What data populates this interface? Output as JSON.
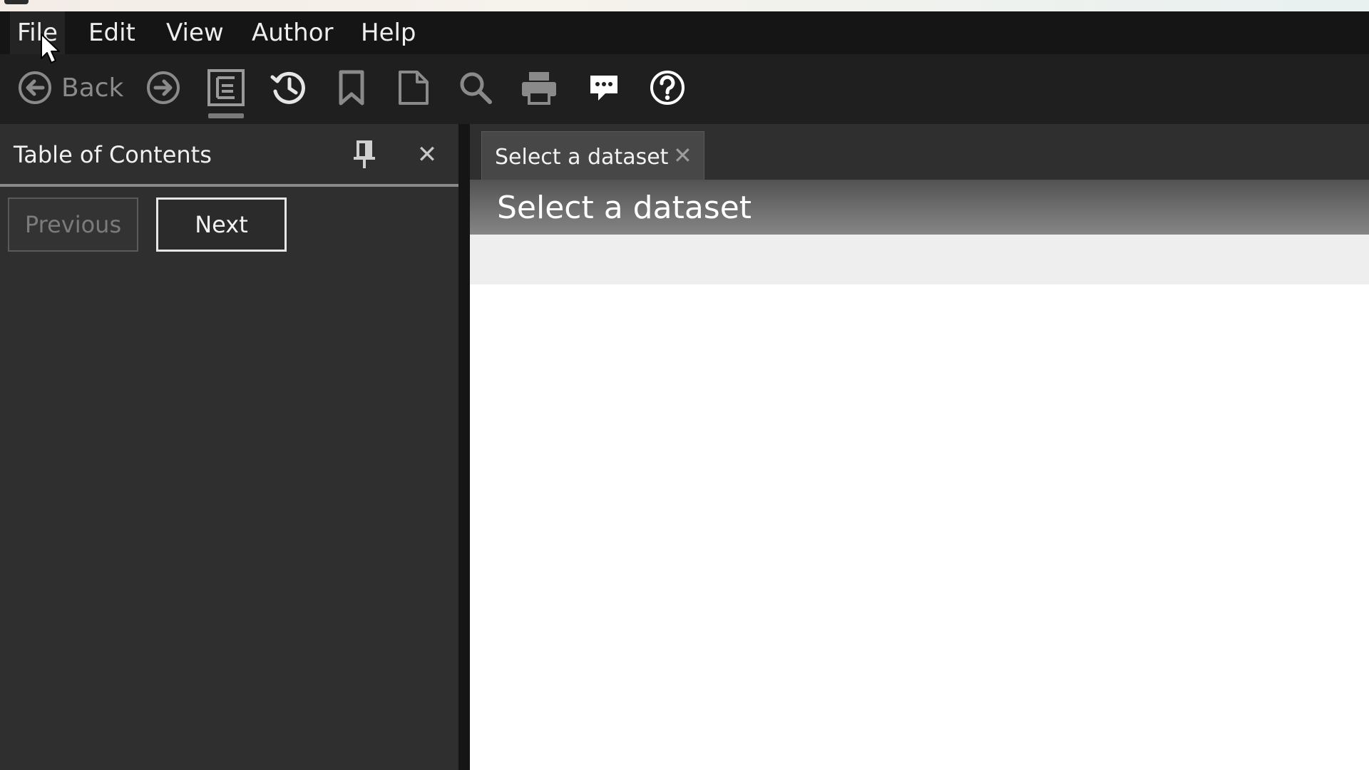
{
  "menu": {
    "items": [
      {
        "label": "File"
      },
      {
        "label": "Edit"
      },
      {
        "label": "View"
      },
      {
        "label": "Author"
      },
      {
        "label": "Help"
      }
    ]
  },
  "toolbar": {
    "back_label": "Back",
    "icons": [
      "back-icon",
      "forward-icon",
      "contents-icon",
      "history-icon",
      "bookmark-icon",
      "page-icon",
      "search-icon",
      "print-icon",
      "feedback-icon",
      "help-icon"
    ],
    "selected": "contents-icon"
  },
  "toc": {
    "title": "Table of Contents",
    "previous_label": "Previous",
    "next_label": "Next"
  },
  "document": {
    "tab_label": "Select a dataset",
    "tab_close": "✕",
    "heading": "Select a dataset"
  },
  "colors": {
    "menubar": "#151515",
    "toolbar": "#1f1f1f",
    "pane": "#2f2f2f",
    "heading_gradient_start": "#525252",
    "heading_gradient_end": "#858585"
  }
}
